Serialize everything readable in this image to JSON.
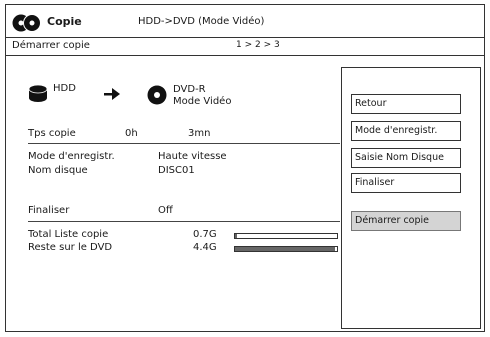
{
  "header": {
    "app_title": "Copie",
    "mode_title": "HDD->DVD (Mode Vidéo)"
  },
  "subheader": {
    "label": "Démarrer copie",
    "step": "1 > 2 > 3"
  },
  "source": {
    "label": "HDD"
  },
  "target": {
    "line1": "DVD-R",
    "line2": "Mode Vidéo"
  },
  "rows": {
    "tps_label": "Tps copie",
    "tps_hours": "0h",
    "tps_minutes": "3mn",
    "mode_label": "Mode d'enregistr.",
    "mode_value": "Haute vitesse",
    "disc_label": "Nom disque",
    "disc_value": "DISC01",
    "finalize_label": "Finaliser",
    "finalize_value": "Off",
    "total_label": "Total Liste copie",
    "total_value": "0.7G",
    "total_fraction": 0.02,
    "remaining_label": "Reste sur le DVD",
    "remaining_value": "4.4G",
    "remaining_fraction": 0.98
  },
  "menu": {
    "retour": "Retour",
    "mode": "Mode d'enregistr.",
    "saisie": "Saisie Nom Disque",
    "finaliser": "Finaliser",
    "demarrer": "Démarrer copie"
  },
  "icons": {
    "logo": "dvd-logo-icon",
    "hdd": "hdd-icon",
    "arrow": "arrow-right-icon",
    "disc": "disc-icon"
  }
}
